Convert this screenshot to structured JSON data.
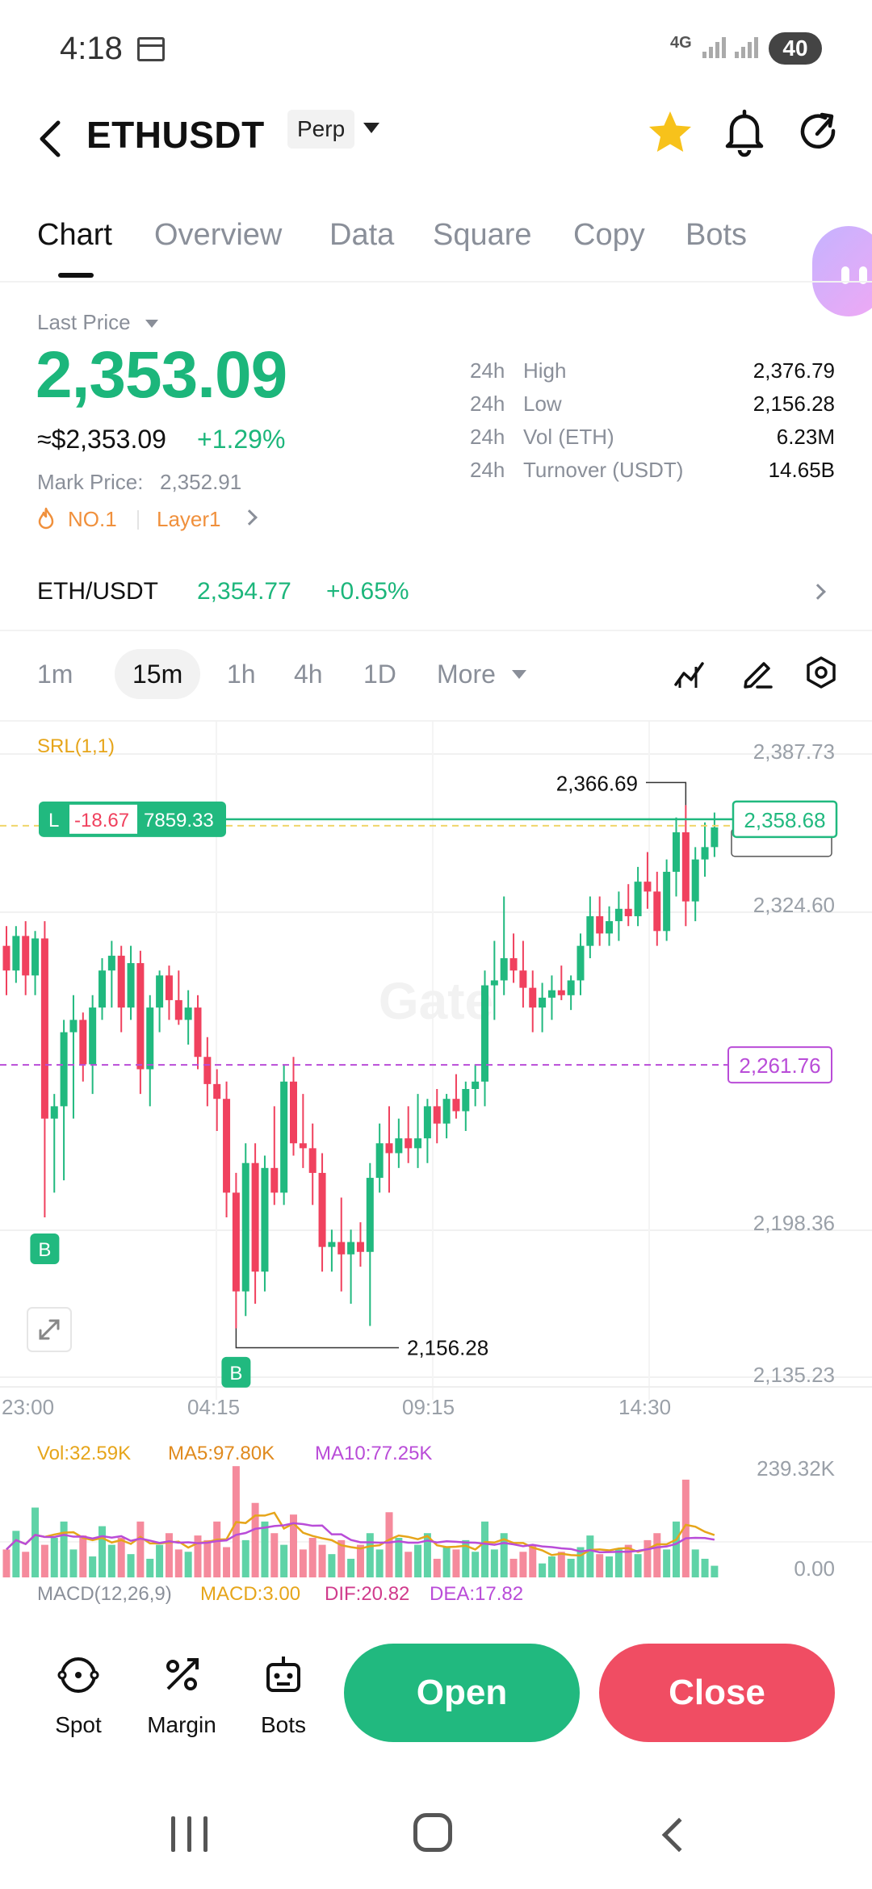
{
  "status_bar": {
    "time": "4:18",
    "network": "4G",
    "battery": "40"
  },
  "header": {
    "pair": "ETHUSDT",
    "contract_type": "Perp",
    "icons": [
      "back-arrow-icon",
      "star-icon",
      "bell-icon",
      "share-refresh-icon"
    ],
    "star_color": "#f7c21b"
  },
  "tabs": [
    {
      "label": "Chart",
      "active": true
    },
    {
      "label": "Overview"
    },
    {
      "label": "Data"
    },
    {
      "label": "Square"
    },
    {
      "label": "Copy"
    },
    {
      "label": "Bots"
    }
  ],
  "price": {
    "label": "Last Price",
    "last": "2,353.09",
    "usd": "≈$2,353.09",
    "change_pct": "+1.29%",
    "mark_label": "Mark Price:",
    "mark_value": "2,352.91",
    "rank_tag": "NO.1",
    "category_tag": "Layer1",
    "stats": [
      {
        "period": "24h",
        "key": "High",
        "value": "2,376.79"
      },
      {
        "period": "24h",
        "key": "Low",
        "value": "2,156.28"
      },
      {
        "period": "24h",
        "key": "Vol (ETH)",
        "value": "6.23M"
      },
      {
        "period": "24h",
        "key": "Turnover (USDT)",
        "value": "14.65B"
      }
    ]
  },
  "spot": {
    "pair": "ETH/USDT",
    "price": "2,354.77",
    "change_pct": "+0.65%"
  },
  "intervals": [
    {
      "label": "1m"
    },
    {
      "label": "15m",
      "active": true
    },
    {
      "label": "1h"
    },
    {
      "label": "4h"
    },
    {
      "label": "1D"
    },
    {
      "label": "More"
    }
  ],
  "chart_data": {
    "type": "candlestick",
    "indicator_label": "SRL(1,1)",
    "watermark": "Gate",
    "y_axis_ticks": [
      "2,387.73",
      "2,324.60",
      "2,198.36",
      "2,135.23"
    ],
    "y_range": [
      2135.23,
      2387.73
    ],
    "x_axis_ticks": [
      "23:00",
      "04:15",
      "09:15",
      "14:30"
    ],
    "current_price_label": "2,358.68",
    "current_price": 2358.68,
    "position": {
      "side": "L",
      "pnl": "-18.67",
      "size": "7859.33"
    },
    "alert_line": {
      "label": "2,261.76",
      "value": 2261.76
    },
    "annotations": {
      "high": "2,366.69",
      "low": "2,156.28",
      "buy_marker": "B"
    },
    "candles": [
      [
        2310,
        2318,
        2290,
        2300
      ],
      [
        2300,
        2318,
        2295,
        2314
      ],
      [
        2314,
        2320,
        2290,
        2298
      ],
      [
        2298,
        2316,
        2290,
        2313
      ],
      [
        2313,
        2320,
        2200,
        2240
      ],
      [
        2240,
        2250,
        2210,
        2245
      ],
      [
        2245,
        2280,
        2215,
        2275
      ],
      [
        2275,
        2290,
        2240,
        2280
      ],
      [
        2280,
        2283,
        2255,
        2262
      ],
      [
        2262,
        2290,
        2250,
        2285
      ],
      [
        2285,
        2305,
        2280,
        2300
      ],
      [
        2300,
        2312,
        2285,
        2306
      ],
      [
        2306,
        2310,
        2275,
        2285
      ],
      [
        2285,
        2310,
        2280,
        2303
      ],
      [
        2303,
        2308,
        2250,
        2260
      ],
      [
        2260,
        2290,
        2245,
        2285
      ],
      [
        2285,
        2300,
        2275,
        2298
      ],
      [
        2298,
        2302,
        2280,
        2288
      ],
      [
        2288,
        2300,
        2278,
        2280
      ],
      [
        2280,
        2292,
        2270,
        2285
      ],
      [
        2285,
        2290,
        2260,
        2265
      ],
      [
        2265,
        2273,
        2245,
        2254
      ],
      [
        2254,
        2260,
        2235,
        2248
      ],
      [
        2248,
        2255,
        2200,
        2210
      ],
      [
        2210,
        2218,
        2155,
        2170
      ],
      [
        2170,
        2230,
        2160,
        2222
      ],
      [
        2222,
        2230,
        2165,
        2178
      ],
      [
        2178,
        2225,
        2170,
        2220
      ],
      [
        2220,
        2245,
        2205,
        2210
      ],
      [
        2210,
        2262,
        2205,
        2255
      ],
      [
        2255,
        2265,
        2225,
        2230
      ],
      [
        2230,
        2250,
        2220,
        2228
      ],
      [
        2228,
        2238,
        2205,
        2218
      ],
      [
        2218,
        2226,
        2178,
        2188
      ],
      [
        2188,
        2195,
        2178,
        2190
      ],
      [
        2190,
        2208,
        2170,
        2185
      ],
      [
        2185,
        2195,
        2165,
        2190
      ],
      [
        2190,
        2198,
        2180,
        2186
      ],
      [
        2186,
        2222,
        2156,
        2216
      ],
      [
        2216,
        2238,
        2210,
        2230
      ],
      [
        2230,
        2245,
        2210,
        2226
      ],
      [
        2226,
        2240,
        2220,
        2232
      ],
      [
        2232,
        2245,
        2222,
        2228
      ],
      [
        2228,
        2250,
        2220,
        2232
      ],
      [
        2232,
        2248,
        2222,
        2245
      ],
      [
        2245,
        2252,
        2230,
        2238
      ],
      [
        2238,
        2250,
        2232,
        2248
      ],
      [
        2248,
        2258,
        2240,
        2243
      ],
      [
        2243,
        2255,
        2235,
        2252
      ],
      [
        2252,
        2262,
        2245,
        2255
      ],
      [
        2255,
        2300,
        2245,
        2294
      ],
      [
        2294,
        2312,
        2280,
        2296
      ],
      [
        2296,
        2330,
        2290,
        2305
      ],
      [
        2305,
        2315,
        2295,
        2300
      ],
      [
        2300,
        2312,
        2285,
        2293
      ],
      [
        2293,
        2300,
        2275,
        2285
      ],
      [
        2285,
        2295,
        2275,
        2289
      ],
      [
        2289,
        2298,
        2280,
        2292
      ],
      [
        2292,
        2302,
        2288,
        2290
      ],
      [
        2290,
        2298,
        2284,
        2296
      ],
      [
        2296,
        2315,
        2290,
        2310
      ],
      [
        2310,
        2330,
        2305,
        2322
      ],
      [
        2322,
        2330,
        2310,
        2315
      ],
      [
        2315,
        2326,
        2310,
        2320
      ],
      [
        2320,
        2332,
        2312,
        2325
      ],
      [
        2325,
        2335,
        2318,
        2322
      ],
      [
        2322,
        2342,
        2318,
        2336
      ],
      [
        2336,
        2348,
        2325,
        2332
      ],
      [
        2332,
        2340,
        2310,
        2316
      ],
      [
        2316,
        2345,
        2312,
        2340
      ],
      [
        2340,
        2362,
        2330,
        2356
      ],
      [
        2356,
        2367,
        2318,
        2328
      ],
      [
        2328,
        2350,
        2320,
        2345
      ],
      [
        2345,
        2360,
        2338,
        2350
      ],
      [
        2350,
        2364,
        2346,
        2358
      ]
    ],
    "volume": {
      "label": "Vol:32.59K",
      "ma5_label": "MA5:97.80K",
      "ma10_label": "MA10:77.25K",
      "y_ticks": [
        "239.32K",
        "0.00"
      ],
      "y_range": [
        0,
        239.32
      ],
      "values": [
        60,
        100,
        55,
        150,
        70,
        85,
        120,
        60,
        90,
        45,
        110,
        70,
        85,
        50,
        120,
        40,
        70,
        95,
        60,
        55,
        90,
        80,
        120,
        65,
        239,
        80,
        160,
        120,
        95,
        70,
        135,
        60,
        85,
        70,
        50,
        80,
        40,
        70,
        95,
        60,
        140,
        85,
        55,
        70,
        95,
        40,
        65,
        60,
        80,
        55,
        120,
        60,
        95,
        40,
        55,
        70,
        30,
        45,
        55,
        40,
        65,
        90,
        50,
        45,
        60,
        70,
        50,
        80,
        95,
        60,
        120,
        210,
        60,
        40,
        25
      ]
    },
    "macd": {
      "label": "MACD(12,26,9)",
      "macd": "MACD:3.00",
      "dif": "DIF:20.82",
      "dea": "DEA:17.82"
    },
    "colors": {
      "up": "#21b97f",
      "down": "#f0415e",
      "current": "#21b97f",
      "alert": "#b94cd8",
      "srl": "#e6a51a"
    }
  },
  "bottom_bar": {
    "items": [
      {
        "label": "Spot",
        "icon": "spot-swap-icon"
      },
      {
        "label": "Margin",
        "icon": "margin-percent-icon"
      },
      {
        "label": "Bots",
        "icon": "bot-icon"
      }
    ],
    "open": "Open",
    "close": "Close"
  }
}
